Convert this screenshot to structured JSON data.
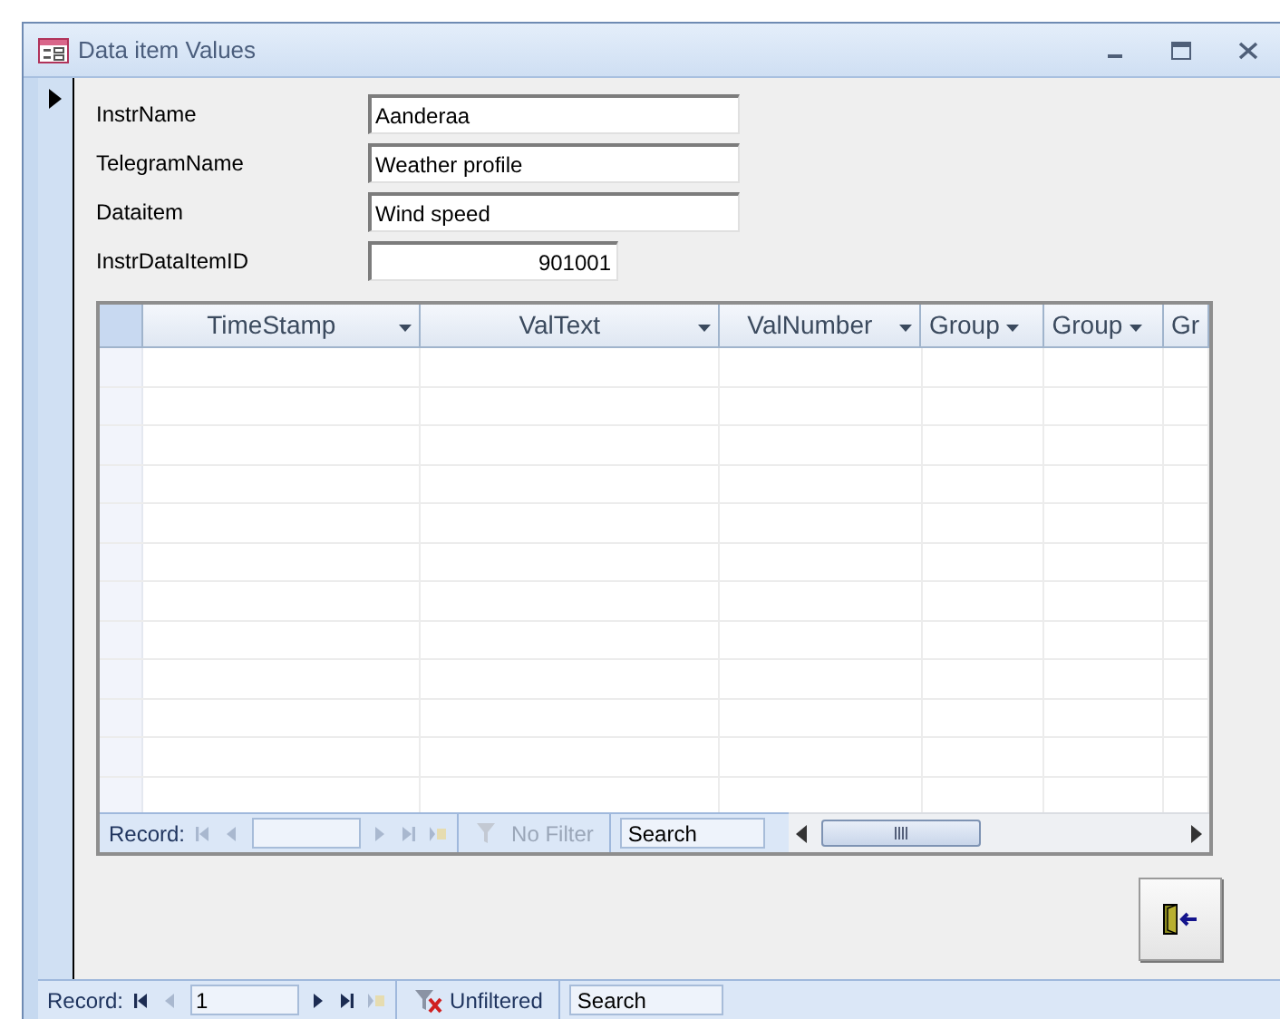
{
  "window": {
    "title": "Data item Values"
  },
  "fields": [
    {
      "label": "InstrName",
      "value": "Aanderaa",
      "kind": "text"
    },
    {
      "label": "TelegramName",
      "value": "Weather profile",
      "kind": "text"
    },
    {
      "label": "Dataitem",
      "value": "Wind speed",
      "kind": "text"
    },
    {
      "label": "InstrDataItemID",
      "value": "901001",
      "kind": "number"
    }
  ],
  "datasheet": {
    "columns": [
      "TimeStamp",
      "ValText",
      "ValNumber",
      "Group",
      "Group",
      "Gr"
    ],
    "navigator": {
      "label": "Record:",
      "buttons": [
        {
          "kind": "first",
          "disabled": true
        },
        {
          "kind": "prev",
          "disabled": true
        },
        {
          "kind": "next",
          "disabled": true
        },
        {
          "kind": "last",
          "disabled": true
        },
        {
          "kind": "new",
          "disabled": true
        }
      ],
      "filter": {
        "text": "No Filter",
        "active": false
      },
      "search": "Search"
    }
  },
  "navigator": {
    "label": "Record:",
    "current": "1",
    "buttons": [
      {
        "kind": "first",
        "disabled": false
      },
      {
        "kind": "prev",
        "disabled": true
      },
      {
        "kind": "next",
        "disabled": false
      },
      {
        "kind": "last",
        "disabled": false
      },
      {
        "kind": "new",
        "disabled": true
      }
    ],
    "filter": {
      "text": "Unfiltered",
      "active": true
    },
    "search": "Search"
  }
}
